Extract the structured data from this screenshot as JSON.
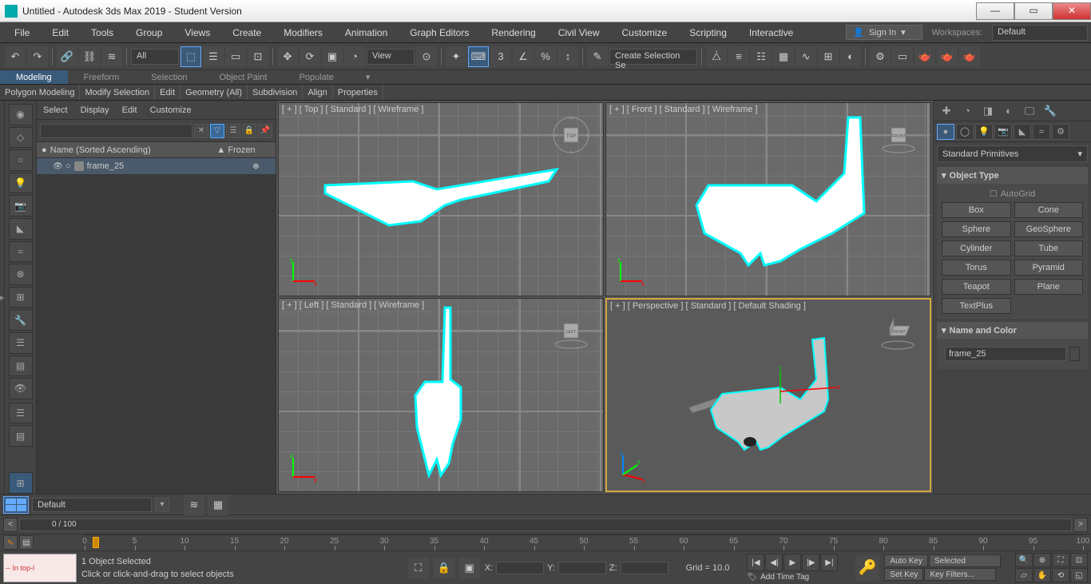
{
  "window": {
    "title": "Untitled - Autodesk 3ds Max 2019 - Student Version"
  },
  "menubar": [
    "File",
    "Edit",
    "Tools",
    "Group",
    "Views",
    "Create",
    "Modifiers",
    "Animation",
    "Graph Editors",
    "Rendering",
    "Civil View",
    "Customize",
    "Scripting",
    "Interactive"
  ],
  "signin": {
    "label": "Sign In",
    "workspaces_label": "Workspaces:",
    "workspaces_value": "Default"
  },
  "toolbar": {
    "filter_drop": "All",
    "view_drop": "View",
    "sel_set_drop": "Create Selection Se"
  },
  "ribbon_tabs": [
    "Modeling",
    "Freeform",
    "Selection",
    "Object Paint",
    "Populate"
  ],
  "ribbon_items": [
    "Polygon Modeling",
    "Modify Selection",
    "Edit",
    "Geometry (All)",
    "Subdivision",
    "Align",
    "Properties"
  ],
  "scene_explorer": {
    "tabs": [
      "Select",
      "Display",
      "Edit",
      "Customize"
    ],
    "header_col1": "Name (Sorted Ascending)",
    "header_col2": "Frozen",
    "items": [
      {
        "name": "frame_25"
      }
    ]
  },
  "viewports": [
    {
      "label": "[ + ] [ Top ] [ Standard ] [ Wireframe ]"
    },
    {
      "label": "[ + ] [ Front ] [ Standard ] [ Wireframe ]"
    },
    {
      "label": "[ + ] [ Left ] [ Standard ] [ Wireframe ]"
    },
    {
      "label": "[ + ] [ Perspective ] [ Standard ] [ Default Shading ]"
    }
  ],
  "command_panel": {
    "category": "Standard Primitives",
    "obj_type_title": "Object Type",
    "autogrid": "AutoGrid",
    "buttons": [
      [
        "Box",
        "Cone"
      ],
      [
        "Sphere",
        "GeoSphere"
      ],
      [
        "Cylinder",
        "Tube"
      ],
      [
        "Torus",
        "Pyramid"
      ],
      [
        "Teapot",
        "Plane"
      ],
      [
        "TextPlus",
        ""
      ]
    ],
    "name_color_title": "Name and Color",
    "name_value": "frame_25",
    "color": "#7af0d0"
  },
  "layer_bar": {
    "default": "Default"
  },
  "time_slider": {
    "pos": "0 / 100"
  },
  "ruler_ticks": [
    0,
    5,
    10,
    15,
    20,
    25,
    30,
    35,
    40,
    45,
    50,
    55,
    60,
    65,
    70,
    75,
    80,
    85,
    90,
    95,
    100
  ],
  "status": {
    "sel_text": "-- In top-l",
    "line1": "1 Object Selected",
    "line2": "Click or click-and-drag to select objects",
    "x": "X:",
    "y": "Y:",
    "z": "Z:",
    "grid": "Grid = 10.0",
    "add_tag": "Add Time Tag",
    "autokey": "Auto Key",
    "setkey": "Set Key",
    "keyfilters": "Key Filters...",
    "selected": "Selected"
  }
}
